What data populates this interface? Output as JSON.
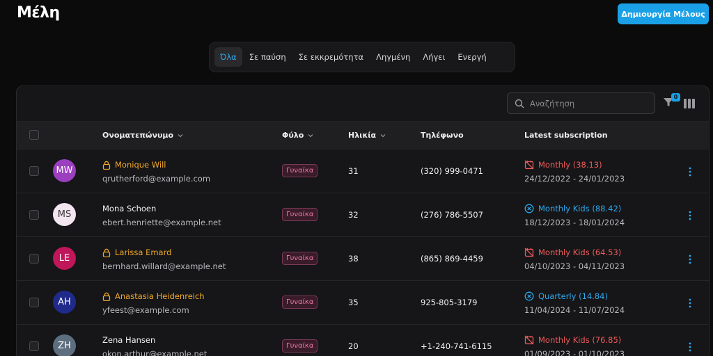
{
  "header": {
    "title": "Μέλη",
    "create_label": "Δημιουργία Μέλους"
  },
  "tabs": [
    {
      "label": "Όλα",
      "active": true
    },
    {
      "label": "Σε παύση",
      "active": false
    },
    {
      "label": "Σε εκκρεμότητα",
      "active": false
    },
    {
      "label": "Ληγμένη",
      "active": false
    },
    {
      "label": "Λήγει",
      "active": false
    },
    {
      "label": "Ενεργή",
      "active": false
    }
  ],
  "toolbar": {
    "search_placeholder": "Αναζήτηση",
    "filter_count": "0"
  },
  "table": {
    "columns": {
      "name": "Ονοματεπώνυμο",
      "gender": "Φύλο",
      "age": "Ηλικία",
      "phone": "Τηλέφωνο",
      "subscription": "Latest subscription"
    },
    "rows": [
      {
        "initials": "MW",
        "avatar_color": "#9b3fc0",
        "name": "Monique Will",
        "locked": true,
        "email": "qrutherford@example.com",
        "gender": "Γυναίκα",
        "age": "31",
        "phone": "(320) 999-0471",
        "subscription": "Monthly (38.13)",
        "sub_status": "expired",
        "dates": "24/12/2022 - 24/01/2023"
      },
      {
        "initials": "MS",
        "avatar_color": "#f3e6f0",
        "avatar_text_color": "#333333",
        "name": "Mona Schoen",
        "locked": false,
        "email": "ebert.henriette@example.net",
        "gender": "Γυναίκα",
        "age": "32",
        "phone": "(276) 786-5507",
        "subscription": "Monthly Kids (88.42)",
        "sub_status": "cancelled",
        "dates": "18/12/2023 - 18/01/2024"
      },
      {
        "initials": "LE",
        "avatar_color": "#c0175a",
        "name": "Larissa Emard",
        "locked": true,
        "email": "bernhard.willard@example.net",
        "gender": "Γυναίκα",
        "age": "38",
        "phone": "(865) 869-4459",
        "subscription": "Monthly Kids (64.53)",
        "sub_status": "expired",
        "dates": "04/10/2023 - 04/11/2023"
      },
      {
        "initials": "AH",
        "avatar_color": "#1f2a8a",
        "name": "Anastasia Heidenreich",
        "locked": true,
        "email": "yfeest@example.com",
        "gender": "Γυναίκα",
        "age": "35",
        "phone": "925-805-3179",
        "subscription": "Quarterly (14.84)",
        "sub_status": "cancelled",
        "dates": "11/04/2024 - 11/07/2024"
      },
      {
        "initials": "ZH",
        "avatar_color": "#5d6f7f",
        "name": "Zena Hansen",
        "locked": false,
        "email": "okon.arthur@example.net",
        "gender": "Γυναίκα",
        "age": "20",
        "phone": "+1-240-741-6115",
        "subscription": "Monthly Kids (76.85)",
        "sub_status": "expired",
        "dates": "01/09/2023 - 01/10/2023"
      }
    ]
  },
  "colors": {
    "accent": "#1aa0e6",
    "locked": "#f0a82a",
    "expired": "#f05a5a",
    "cancelled": "#2ea8ee"
  }
}
